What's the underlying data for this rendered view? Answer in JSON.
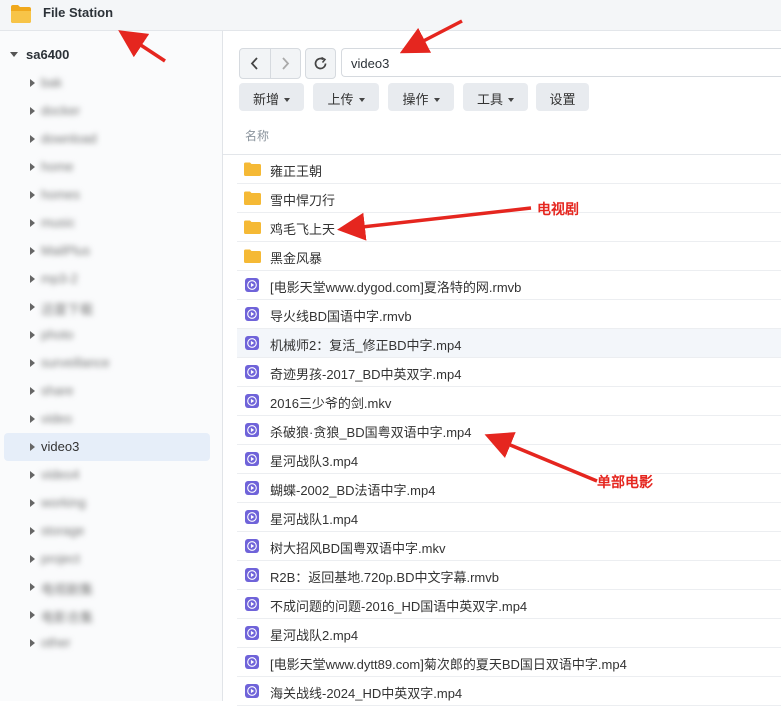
{
  "app": {
    "title": "File Station",
    "icon": "folder-icon"
  },
  "sidebar": {
    "root_label": "sa6400",
    "items": [
      {
        "label": "bak",
        "blurred": true,
        "selected": false
      },
      {
        "label": "docker",
        "blurred": true,
        "selected": false
      },
      {
        "label": "download",
        "blurred": true,
        "selected": false
      },
      {
        "label": "home",
        "blurred": true,
        "selected": false
      },
      {
        "label": "homes",
        "blurred": true,
        "selected": false
      },
      {
        "label": "music",
        "blurred": true,
        "selected": false
      },
      {
        "label": "MailPlus",
        "blurred": true,
        "selected": false
      },
      {
        "label": "mp3-2",
        "blurred": true,
        "selected": false
      },
      {
        "label": "迅雷下载",
        "blurred": true,
        "selected": false
      },
      {
        "label": "photo",
        "blurred": true,
        "selected": false
      },
      {
        "label": "surveillance",
        "blurred": true,
        "selected": false
      },
      {
        "label": "share",
        "blurred": true,
        "selected": false
      },
      {
        "label": "video",
        "blurred": true,
        "selected": false
      },
      {
        "label": "video3",
        "blurred": false,
        "selected": true
      },
      {
        "label": "video4",
        "blurred": true,
        "selected": false
      },
      {
        "label": "working",
        "blurred": true,
        "selected": false
      },
      {
        "label": "storage",
        "blurred": true,
        "selected": false
      },
      {
        "label": "project",
        "blurred": true,
        "selected": false
      },
      {
        "label": "电视剧集",
        "blurred": true,
        "selected": false
      },
      {
        "label": "电影合集",
        "blurred": true,
        "selected": false
      },
      {
        "label": "other",
        "blurred": true,
        "selected": false
      }
    ]
  },
  "toolbar": {
    "path_value": "video3",
    "buttons": [
      "新增",
      "上传",
      "操作",
      "工具",
      "设置"
    ]
  },
  "list": {
    "column_name": "名称",
    "files": [
      {
        "name": "雍正王朝",
        "type": "folder"
      },
      {
        "name": "雪中悍刀行",
        "type": "folder"
      },
      {
        "name": "鸡毛飞上天",
        "type": "folder"
      },
      {
        "name": "黑金风暴",
        "type": "folder"
      },
      {
        "name": "[电影天堂www.dygod.com]夏洛特的网.rmvb",
        "type": "video"
      },
      {
        "name": "导火线BD国语中字.rmvb",
        "type": "video"
      },
      {
        "name": "机械师2：复活_修正BD中字.mp4",
        "type": "video"
      },
      {
        "name": "奇迹男孩-2017_BD中英双字.mp4",
        "type": "video"
      },
      {
        "name": "2016三少爷的剑.mkv",
        "type": "video"
      },
      {
        "name": "杀破狼·贪狼_BD国粤双语中字.mp4",
        "type": "video"
      },
      {
        "name": "星河战队3.mp4",
        "type": "video"
      },
      {
        "name": "蝴蝶-2002_BD法语中字.mp4",
        "type": "video"
      },
      {
        "name": "星河战队1.mp4",
        "type": "video"
      },
      {
        "name": "树大招风BD国粤双语中字.mkv",
        "type": "video"
      },
      {
        "name": "R2B：返回基地.720p.BD中文字幕.rmvb",
        "type": "video"
      },
      {
        "name": "不成问题的问题-2016_HD国语中英双字.mp4",
        "type": "video"
      },
      {
        "name": "星河战队2.mp4",
        "type": "video"
      },
      {
        "name": "[电影天堂www.dytt89.com]菊次郎的夏天BD国日双语中字.mp4",
        "type": "video"
      },
      {
        "name": "海关战线-2024_HD中英双字.mp4",
        "type": "video"
      }
    ]
  },
  "annotations": {
    "tv_label": "电视剧",
    "movie_label": "单部电影",
    "color": "#e5261f"
  },
  "colors": {
    "folder": "#f5b935",
    "video_icon": "#6f63d9",
    "selected_bg": "#e6eef9"
  }
}
